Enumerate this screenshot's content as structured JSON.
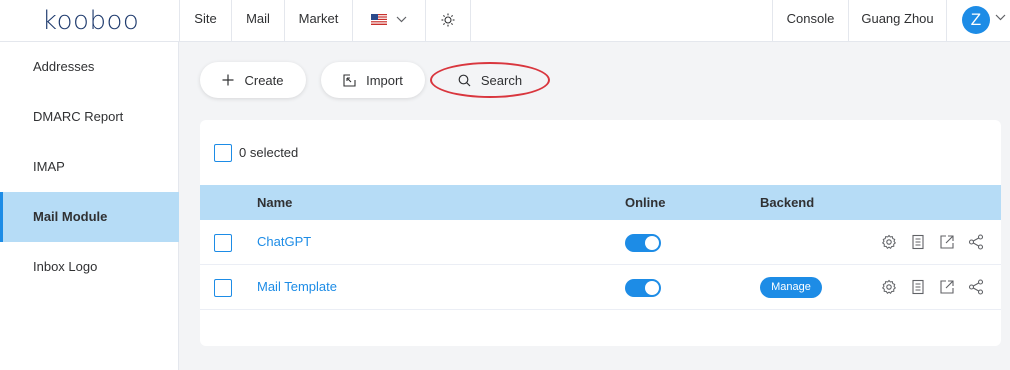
{
  "brand": {
    "logo_text": "kooboo"
  },
  "topnav": {
    "items": [
      "Site",
      "Mail",
      "Market"
    ],
    "console": "Console",
    "region": "Guang Zhou",
    "avatar_initial": "Z"
  },
  "sidebar": {
    "items": [
      {
        "label": "Addresses",
        "active": false
      },
      {
        "label": "DMARC Report",
        "active": false
      },
      {
        "label": "IMAP",
        "active": false
      },
      {
        "label": "Mail Module",
        "active": true
      },
      {
        "label": "Inbox Logo",
        "active": false
      }
    ]
  },
  "toolbar": {
    "create": "Create",
    "import": "Import",
    "search": "Search"
  },
  "table": {
    "selected_text": "0 selected",
    "columns": {
      "name": "Name",
      "online": "Online",
      "backend": "Backend"
    },
    "rows": [
      {
        "name": "ChatGPT",
        "online": true,
        "backend": ""
      },
      {
        "name": "Mail Template",
        "online": true,
        "backend": "Manage"
      }
    ]
  },
  "colors": {
    "accent": "#1d8ce6",
    "selected_bg": "#b6dcf6",
    "highlight": "#d9363e"
  },
  "icons": [
    "plus-icon",
    "import-icon",
    "search-icon",
    "settings-icon",
    "document-icon",
    "external-link-icon",
    "share-icon",
    "sun-icon",
    "us-flag-icon",
    "chevron-down-icon"
  ]
}
